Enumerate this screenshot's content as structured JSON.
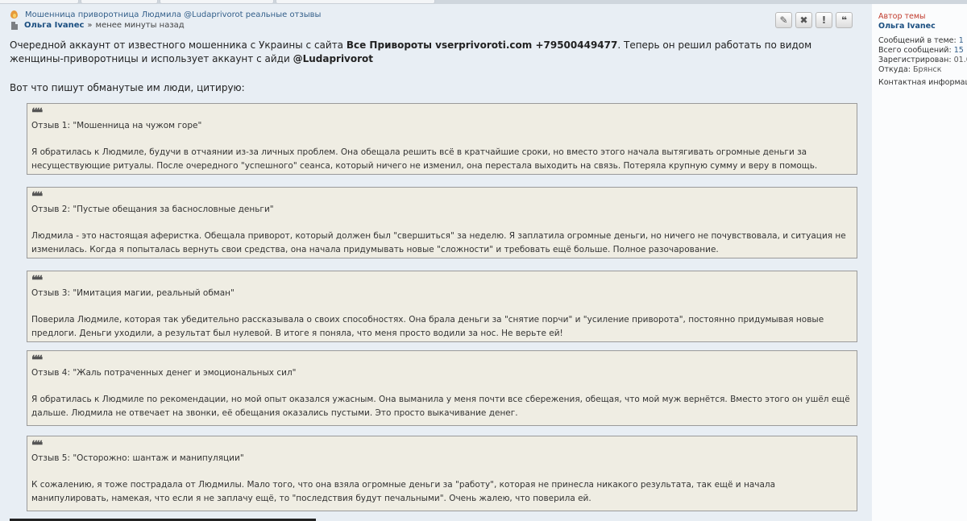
{
  "post_header": {
    "topic_title": "Мошенница приворотница Людмила @Ludaprivorot реальные отзывы",
    "author": "Ольга Ivanec",
    "separator": "»",
    "time_ago": "менее минуты назад"
  },
  "tools": {
    "edit_icon": "pencil-icon",
    "delete_icon": "close-icon",
    "report_icon": "exclamation-icon",
    "quote_icon": "quote-icon",
    "edit_glyph": "✎",
    "delete_glyph": "✖",
    "report_glyph": "!",
    "quote_glyph": "❝"
  },
  "intro": {
    "part1": "Очередной аккаунт от известного мошенника с Украины с сайта ",
    "site": "Все Привороты vserprivoroti.com +79500449477",
    "part2": ". Теперь он решил работать по видом женщины-приворотницы и использует аккаунт с айди ",
    "handle": "@Ludaprivorot",
    "citing": "Вот что пишут обманутые им люди, цитирую:"
  },
  "quote_mark": "❝❝",
  "quotes": [
    {
      "title": "Отзыв 1: \"Мошенница на чужом горе\"",
      "body": "Я обратилась к Людмиле, будучи в отчаянии из-за личных проблем. Она обещала решить всё в кратчайшие сроки, но вместо этого начала вытягивать огромные деньги за несуществующие ритуалы. После очередного \"успешного\" сеанса, который ничего не изменил, она перестала выходить на связь. Потеряла крупную сумму и веру в помощь."
    },
    {
      "title": "Отзыв 2: \"Пустые обещания за баснословные деньги\"",
      "body": "Людмила - это настоящая аферистка. Обещала приворот, который должен был \"свершиться\" за неделю. Я заплатила огромные деньги, но ничего не почувствовала, и ситуация не изменилась. Когда я попыталась вернуть свои средства, она начала придумывать новые \"сложности\" и требовать ещё больше. Полное разочарование."
    },
    {
      "title": "Отзыв 3: \"Имитация магии, реальный обман\"",
      "body": "Поверила Людмиле, которая так убедительно рассказывала о своих способностях. Она брала деньги за \"снятие порчи\" и \"усиление приворота\", постоянно придумывая новые предлоги. Деньги уходили, а результат был нулевой. В итоге я поняла, что меня просто водили за нос. Не верьте ей!"
    },
    {
      "title": "Отзыв 4: \"Жаль потраченных денег и эмоциональных сил\"",
      "body": "Я обратилась к Людмиле по рекомендации, но мой опыт оказался ужасным. Она выманила у меня почти все сбережения, обещая, что мой муж вернётся. Вместо этого он ушёл ещё дальше. Людмила не отвечает на звонки, её обещания оказались пустыми. Это просто выкачивание денег."
    },
    {
      "title": "Отзыв 5: \"Осторожно: шантаж и манипуляции\"",
      "body": "К сожалению, я тоже пострадала от Людмилы. Мало того, что она взяла огромные деньги за \"работу\", которая не принесла никакого результата, так ещё и начала манипулировать, намекая, что если я не заплачу ещё, то \"последствия будут печальными\". Очень жалею, что поверила ей."
    }
  ],
  "sidebar": {
    "author_label": "Автор темы",
    "author_name": "Ольга Ivanec",
    "topic_posts_label": "Сообщений в теме:",
    "topic_posts_value": "1",
    "total_posts_label": "Всего сообщений:",
    "total_posts_value": "15",
    "registered_label": "Зарегистрирован:",
    "registered_value": "01.0",
    "location_label": "Откуда:",
    "location_value": "Брянск",
    "contact_label": "Контактная информаци"
  }
}
